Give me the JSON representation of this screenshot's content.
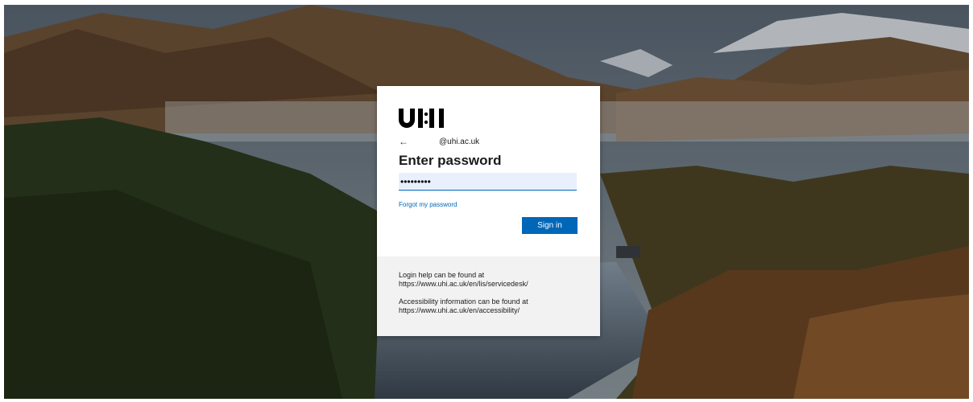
{
  "login": {
    "brand": "UHI",
    "back_icon": "arrow-left-icon",
    "identity": "@uhi.ac.uk",
    "title": "Enter password",
    "password_value": "•••••••••",
    "forgot_link": "Forgot my password",
    "signin_label": "Sign in"
  },
  "footer": {
    "help_line1": "Login help can be found at",
    "help_line2": "https://www.uhi.ac.uk/en/lis/servicedesk/",
    "access_line1": "Accessibility information can be found at",
    "access_line2": "https://www.uhi.ac.uk/en/accessibility/"
  },
  "colors": {
    "accent": "#0067b8",
    "input_bg": "#e8f0fe",
    "footer_bg": "#f2f2f2"
  }
}
